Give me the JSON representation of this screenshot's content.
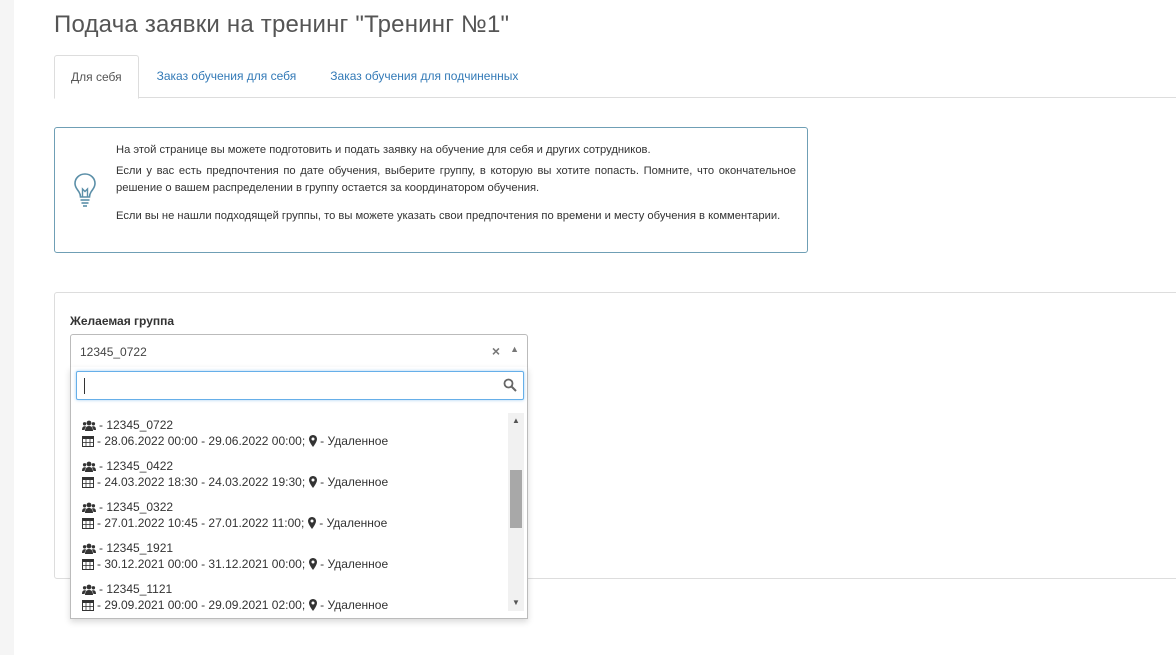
{
  "page": {
    "title": "Подача заявки на тренинг \"Тренинг №1\""
  },
  "tabs": [
    {
      "label": "Для себя",
      "active": true
    },
    {
      "label": "Заказ обучения для себя",
      "active": false
    },
    {
      "label": "Заказ обучения для подчиненных",
      "active": false
    }
  ],
  "info": {
    "p1": "На этой странице вы можете подготовить и подать заявку на обучение для себя и других сотрудников.",
    "p2": "Если у вас есть предпочтения по дате обучения, выберите группу, в которую вы хотите попасть. Помните, что окончательное решение о вашем распределении в группу остается за координатором обучения.",
    "p3": "Если вы не нашли подходящей группы, то вы можете указать свои предпочтения по времени и месту обучения в комментарии.",
    "icon": "lightbulb-icon"
  },
  "group_select": {
    "label": "Желаемая группа",
    "value": "12345_0722",
    "search_value": "",
    "options": [
      {
        "group": "- 12345_0722",
        "dates": "- 28.06.2022 00:00 - 29.06.2022 00:00;",
        "location": "- Удаленное"
      },
      {
        "group": "- 12345_0422",
        "dates": "- 24.03.2022 18:30 - 24.03.2022 19:30;",
        "location": "- Удаленное"
      },
      {
        "group": "- 12345_0322",
        "dates": "- 27.01.2022 10:45 - 27.01.2022 11:00;",
        "location": "- Удаленное"
      },
      {
        "group": "- 12345_1921",
        "dates": "- 30.12.2021 00:00 - 31.12.2021 00:00;",
        "location": "- Удаленное"
      },
      {
        "group": "- 12345_1121",
        "dates": "- 29.09.2021 00:00 - 29.09.2021 02:00;",
        "location": "- Удаленное"
      }
    ]
  },
  "colors": {
    "link": "#337ab7",
    "info_border": "#6f9fb5",
    "primary_button": "#337ab7"
  }
}
